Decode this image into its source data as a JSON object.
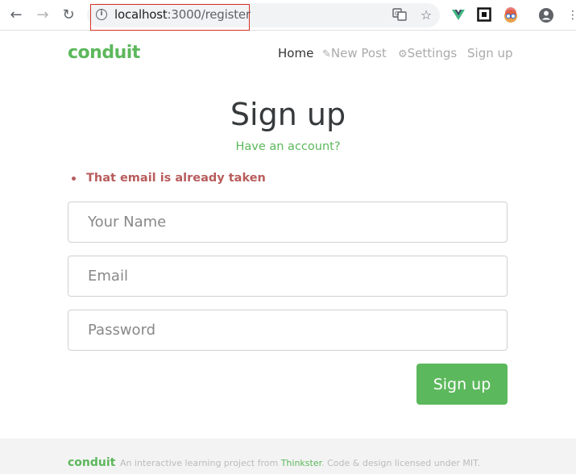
{
  "browser": {
    "url_host": "localhost",
    "url_port_path": ":3000/register",
    "icons": [
      "back-icon",
      "forward-icon",
      "reload-icon",
      "info-icon",
      "translate-icon",
      "star-icon",
      "extension-vue-icon",
      "extension-square-icon",
      "extension-avatar-icon",
      "profile-icon"
    ]
  },
  "navbar": {
    "brand": "conduit",
    "items": [
      {
        "label": "Home",
        "icon": ""
      },
      {
        "label": "New Post",
        "icon": "edit-icon"
      },
      {
        "label": "Settings",
        "icon": "gear-icon"
      },
      {
        "label": "Sign up",
        "icon": ""
      }
    ]
  },
  "form": {
    "title": "Sign up",
    "have_account_link": "Have an account?",
    "errors": [
      "That email is already taken"
    ],
    "name_placeholder": "Your Name",
    "email_placeholder": "Email",
    "password_placeholder": "Password",
    "submit_label": "Sign up"
  },
  "footer": {
    "brand": "conduit",
    "text_before": "An interactive learning project from ",
    "link": "Thinkster",
    "text_after": ". Code & design licensed under MIT."
  },
  "colors": {
    "brand": "#5cb85c",
    "error": "#b85c5c"
  }
}
